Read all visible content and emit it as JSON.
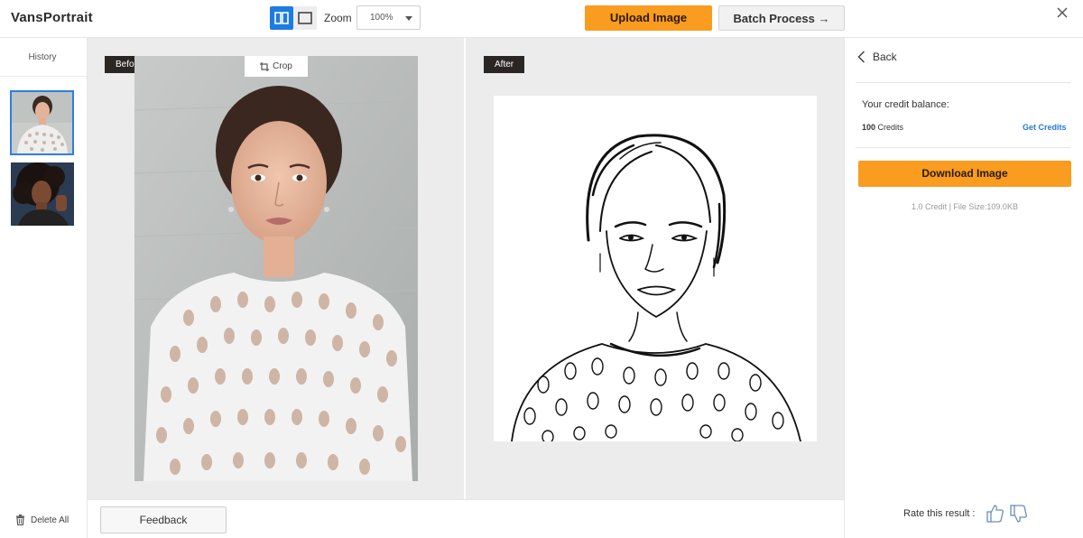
{
  "app": {
    "title": "VansPortrait"
  },
  "toolbar": {
    "zoom_label": "Zoom",
    "zoom_value": "100%",
    "upload_label": "Upload Image",
    "batch_label": "Batch Process →"
  },
  "sidebar": {
    "history_label": "History",
    "delete_all_label": "Delete All"
  },
  "canvas": {
    "before_label": "Before",
    "after_label": "After",
    "crop_label": "Crop"
  },
  "bottom": {
    "feedback_label": "Feedback"
  },
  "panel": {
    "back_label": "Back",
    "credit_title": "Your credit balance:",
    "credit_amount": "100",
    "credit_unit": "Credits",
    "get_credits_label": "Get Credits",
    "download_label": "Download Image",
    "file_info": "1.0 Credit | File Size:109.0KB",
    "rate_label": "Rate this result :"
  },
  "colors": {
    "accent_orange": "#f99c1f",
    "accent_blue": "#1e7be0",
    "tag_dark": "#2b2624",
    "canvas_bg": "#ececec"
  }
}
